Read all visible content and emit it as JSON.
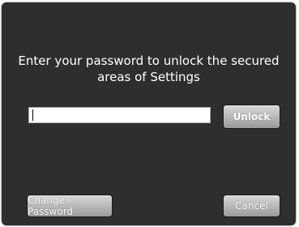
{
  "dialog": {
    "message_line1": "Enter your password to unlock the secured",
    "message_line2": "areas of Settings",
    "password_value": "",
    "unlock_label": "Unlock",
    "change_password_label": "Change Password",
    "cancel_label": "Cancel"
  },
  "colors": {
    "dialog_background": "#2e2e2e",
    "button_gradient_top": "#d8d8d8",
    "button_gradient_bottom": "#9a9a9a",
    "text": "#ffffff"
  }
}
